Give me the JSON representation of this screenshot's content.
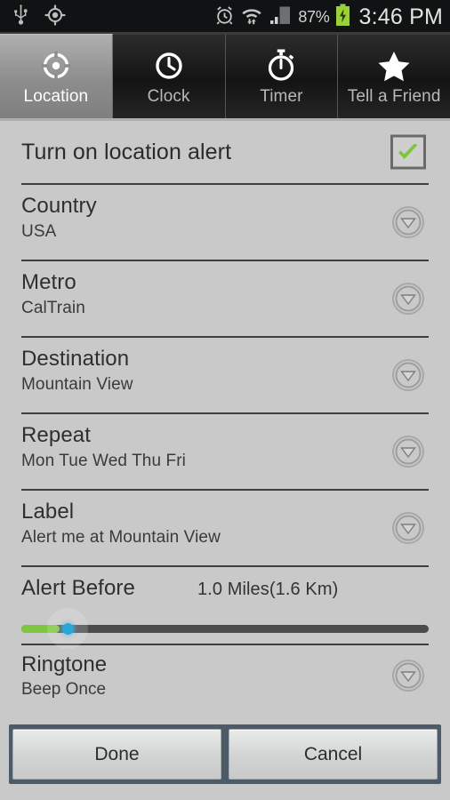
{
  "status_bar": {
    "left_icons": [
      "usb-icon",
      "gps-icon"
    ],
    "alarm_icon": "alarm-icon",
    "wifi_icon": "wifi-icon",
    "signal_icon": "signal-bars-icon",
    "battery_percent": "87%",
    "battery_icon": "battery-charging-icon",
    "time": "3:46 PM"
  },
  "tabs": [
    {
      "label": "Location",
      "icon": "crosshair-icon",
      "selected": true
    },
    {
      "label": "Clock",
      "icon": "clock-icon",
      "selected": false
    },
    {
      "label": "Timer",
      "icon": "stopwatch-icon",
      "selected": false
    },
    {
      "label": "Tell a Friend",
      "icon": "star-icon",
      "selected": false
    }
  ],
  "settings": {
    "toggle": {
      "label": "Turn on location alert",
      "checked": true,
      "check_color": "#7ec63f"
    },
    "items": [
      {
        "title": "Country",
        "value": "USA"
      },
      {
        "title": "Metro",
        "value": "CalTrain"
      },
      {
        "title": "Destination",
        "value": "Mountain View"
      },
      {
        "title": "Repeat",
        "value": "Mon Tue Wed Thu Fri"
      },
      {
        "title": "Label",
        "value": "Alert me at Mountain View"
      }
    ],
    "alert_before": {
      "title": "Alert Before",
      "value": "1.0 Miles(1.6 Km)",
      "slider_percent": 5,
      "fill_color": "#7ec63f",
      "thumb_color": "#2aa7d8"
    },
    "ringtone": {
      "title": "Ringtone",
      "value": "Beep Once"
    }
  },
  "footer": {
    "done_label": "Done",
    "cancel_label": "Cancel",
    "bar_color": "#4d5b68"
  }
}
